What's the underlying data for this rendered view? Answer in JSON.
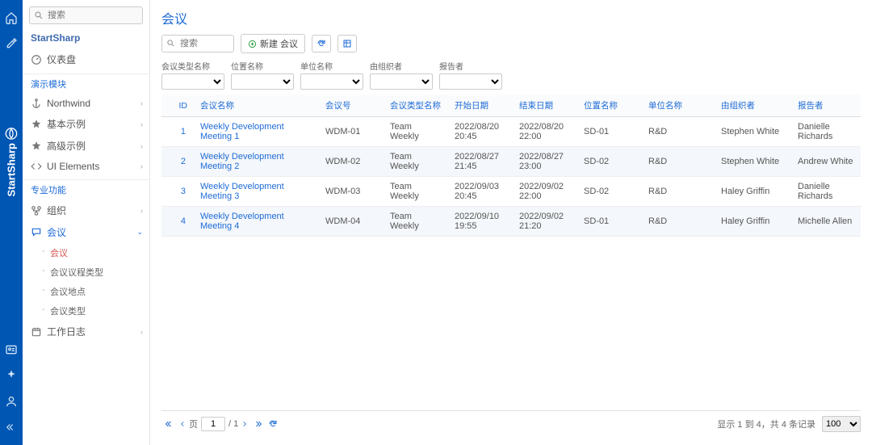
{
  "brand": "StartSharp",
  "sidebar": {
    "search_placeholder": "搜索",
    "title": "StartSharp",
    "dashboard": "仪表盘",
    "section_demo": "演示模块",
    "nav": [
      "Northwind",
      "基本示例",
      "高级示例",
      "UI Elements"
    ],
    "section_pro": "专业功能",
    "org": "组织",
    "meeting": "会议",
    "subs": [
      "会议",
      "会议议程类型",
      "会议地点",
      "会议类型"
    ],
    "worklog": "工作日志"
  },
  "page": {
    "title": "会议",
    "search_placeholder": "搜索",
    "new_button": "新建 会议"
  },
  "filters": {
    "labels": [
      "会议类型名称",
      "位置名称",
      "单位名称",
      "由组织者",
      "报告者"
    ]
  },
  "columns": [
    "ID",
    "会议名称",
    "会议号",
    "会议类型名称",
    "开始日期",
    "结束日期",
    "位置名称",
    "单位名称",
    "由组织者",
    "报告者"
  ],
  "rows": [
    {
      "id": 1,
      "name": "Weekly Development Meeting 1",
      "num": "WDM-01",
      "type": "Team Weekly",
      "start": "2022/08/20 20:45",
      "end": "2022/08/20 22:00",
      "loc": "SD-01",
      "unit": "R&D",
      "org": "Stephen White",
      "rep": "Danielle Richards"
    },
    {
      "id": 2,
      "name": "Weekly Development Meeting 2",
      "num": "WDM-02",
      "type": "Team Weekly",
      "start": "2022/08/27 21:45",
      "end": "2022/08/27 23:00",
      "loc": "SD-02",
      "unit": "R&D",
      "org": "Stephen White",
      "rep": "Andrew White"
    },
    {
      "id": 3,
      "name": "Weekly Development Meeting 3",
      "num": "WDM-03",
      "type": "Team Weekly",
      "start": "2022/09/03 20:45",
      "end": "2022/09/02 22:00",
      "loc": "SD-02",
      "unit": "R&D",
      "org": "Haley Griffin",
      "rep": "Danielle Richards"
    },
    {
      "id": 4,
      "name": "Weekly Development Meeting 4",
      "num": "WDM-04",
      "type": "Team Weekly",
      "start": "2022/09/10 19:55",
      "end": "2022/09/02 21:20",
      "loc": "SD-01",
      "unit": "R&D",
      "org": "Haley Griffin",
      "rep": "Michelle Allen"
    }
  ],
  "pager": {
    "page_label": "页",
    "page_val": "1",
    "page_sep": "/ 1",
    "info": "显示 1 到 4，共 4 条记录",
    "page_size": "100"
  }
}
